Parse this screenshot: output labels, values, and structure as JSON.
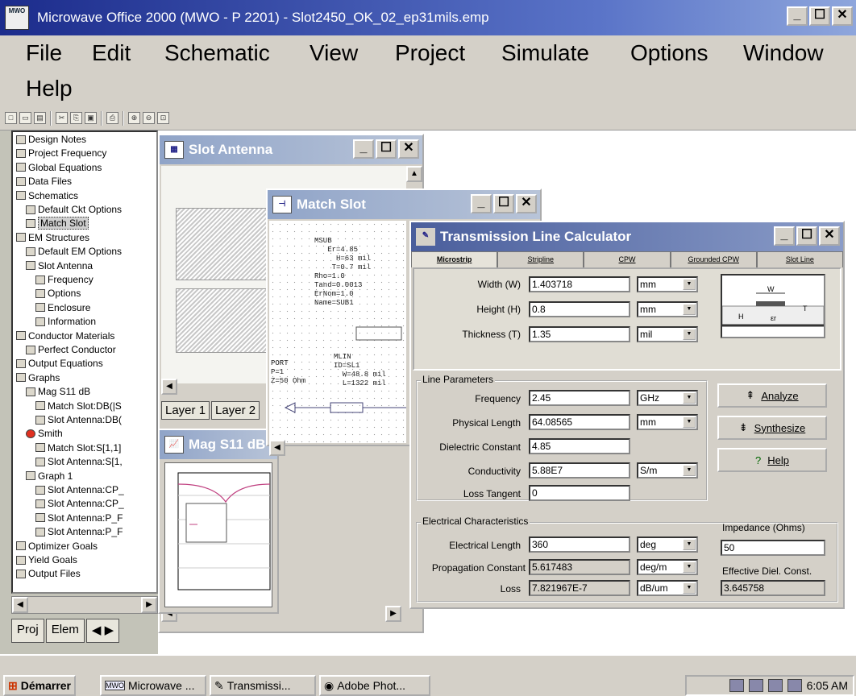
{
  "app": {
    "title": "Microwave Office 2000 (MWO - P 2201) - Slot2450_OK_02_ep31mils.emp",
    "icon_label": "MWO"
  },
  "menu": [
    "File",
    "Edit",
    "Schematic",
    "View",
    "Project",
    "Simulate",
    "Options",
    "Window",
    "Help"
  ],
  "toolbar": {
    "icons": [
      "new-icon",
      "open-icon",
      "save-icon",
      "cut-icon",
      "copy-icon",
      "paste-icon",
      "print-icon",
      "zoom-in-icon",
      "zoom-out-icon",
      "zoom-fit-icon"
    ]
  },
  "tree": {
    "items": [
      {
        "label": "Design Notes",
        "level": 0
      },
      {
        "label": "Project Frequency",
        "level": 0
      },
      {
        "label": "Global Equations",
        "level": 0
      },
      {
        "label": "Data Files",
        "level": 0
      },
      {
        "label": "Schematics",
        "level": 0
      },
      {
        "label": "Default Ckt Options",
        "level": 1
      },
      {
        "label": "Match Slot",
        "level": 1
      },
      {
        "label": "EM Structures",
        "level": 0
      },
      {
        "label": "Default EM Options",
        "level": 1
      },
      {
        "label": "Slot Antenna",
        "level": 1
      },
      {
        "label": "Frequency",
        "level": 2
      },
      {
        "label": "Options",
        "level": 2
      },
      {
        "label": "Enclosure",
        "level": 2
      },
      {
        "label": "Information",
        "level": 2
      },
      {
        "label": "Conductor Materials",
        "level": 0
      },
      {
        "label": "Perfect Conductor",
        "level": 1
      },
      {
        "label": "Output Equations",
        "level": 0
      },
      {
        "label": "Graphs",
        "level": 0
      },
      {
        "label": "Mag S11 dB",
        "level": 1
      },
      {
        "label": "Match Slot:DB(|S",
        "level": 2
      },
      {
        "label": "Slot Antenna:DB(",
        "level": 2
      },
      {
        "label": "Smith",
        "level": 1
      },
      {
        "label": "Match Slot:S[1,1]",
        "level": 2
      },
      {
        "label": "Slot Antenna:S[1,",
        "level": 2
      },
      {
        "label": "Graph 1",
        "level": 1
      },
      {
        "label": "Slot Antenna:CP_",
        "level": 2
      },
      {
        "label": "Slot Antenna:CP_",
        "level": 2
      },
      {
        "label": "Slot Antenna:P_F",
        "level": 2
      },
      {
        "label": "Slot Antenna:P_F",
        "level": 2
      },
      {
        "label": "Optimizer Goals",
        "level": 0
      },
      {
        "label": "Yield Goals",
        "level": 0
      },
      {
        "label": "Output Files",
        "level": 0
      }
    ],
    "tabs": [
      "Proj",
      "Elem"
    ]
  },
  "slot_antenna": {
    "title": "Slot Antenna",
    "layers": [
      "Layer 1",
      "Layer 2"
    ]
  },
  "match_slot": {
    "title": "Match Slot",
    "msub": "MSUB\n   Er=4.85\n     H=63 mil\n    T=0.7 mil\nRho=1.0\nTand=0.0013\nErNom=1.0\nName=SUB1",
    "port": "PORT\nP=1\nZ=50 Ohm",
    "mlin": "MLIN\nID=SL1\n  W=48.8 mil\n  L=1322 mil"
  },
  "graph": {
    "title": "Mag S11 dB"
  },
  "tlc": {
    "title": "Transmission Line Calculator",
    "tabs": [
      "Microstrip",
      "Stripline",
      "CPW",
      "Grounded CPW",
      "Slot Line"
    ],
    "active_tab": "Microstrip",
    "width": {
      "label": "Width (W)",
      "value": "1.403718",
      "unit": "mm"
    },
    "height": {
      "label": "Height (H)",
      "value": "0.8",
      "unit": "mm"
    },
    "thickness": {
      "label": "Thickness (T)",
      "value": "1.35",
      "unit": "mil"
    },
    "line_params": {
      "group": "Line Parameters",
      "frequency": {
        "label": "Frequency",
        "value": "2.45",
        "unit": "GHz"
      },
      "phys_len": {
        "label": "Physical Length",
        "value": "64.08565",
        "unit": "mm"
      },
      "diel": {
        "label": "Dielectric Constant",
        "value": "4.85"
      },
      "cond": {
        "label": "Conductivity",
        "value": "5.88E7",
        "unit": "S/m"
      },
      "loss_tan": {
        "label": "Loss Tangent",
        "value": "0"
      }
    },
    "elec": {
      "group": "Electrical Characteristics",
      "elec_len": {
        "label": "Electrical Length",
        "value": "360",
        "unit": "deg"
      },
      "prop": {
        "label": "Propagation Constant",
        "value": "5.617483",
        "unit": "deg/m"
      },
      "loss": {
        "label": "Loss",
        "value": "7.821967E-7",
        "unit": "dB/um"
      },
      "imp_label": "Impedance (Ohms)",
      "imp_value": "50",
      "eff_label": "Effective Diel. Const.",
      "eff_value": "3.645758"
    },
    "buttons": {
      "analyze": "Analyze",
      "synthesize": "Synthesize",
      "help": "Help"
    },
    "diagram": {
      "w": "W",
      "h": "H",
      "t": "T",
      "er": "εr"
    }
  },
  "taskbar": {
    "start": "Démarrer",
    "items": [
      "Microwave ...",
      "Transmissi...",
      "Adobe Phot..."
    ],
    "clock": "6:05 AM"
  },
  "colors": {
    "title_blue": "#1c2c8c",
    "curve": "#c04080"
  }
}
